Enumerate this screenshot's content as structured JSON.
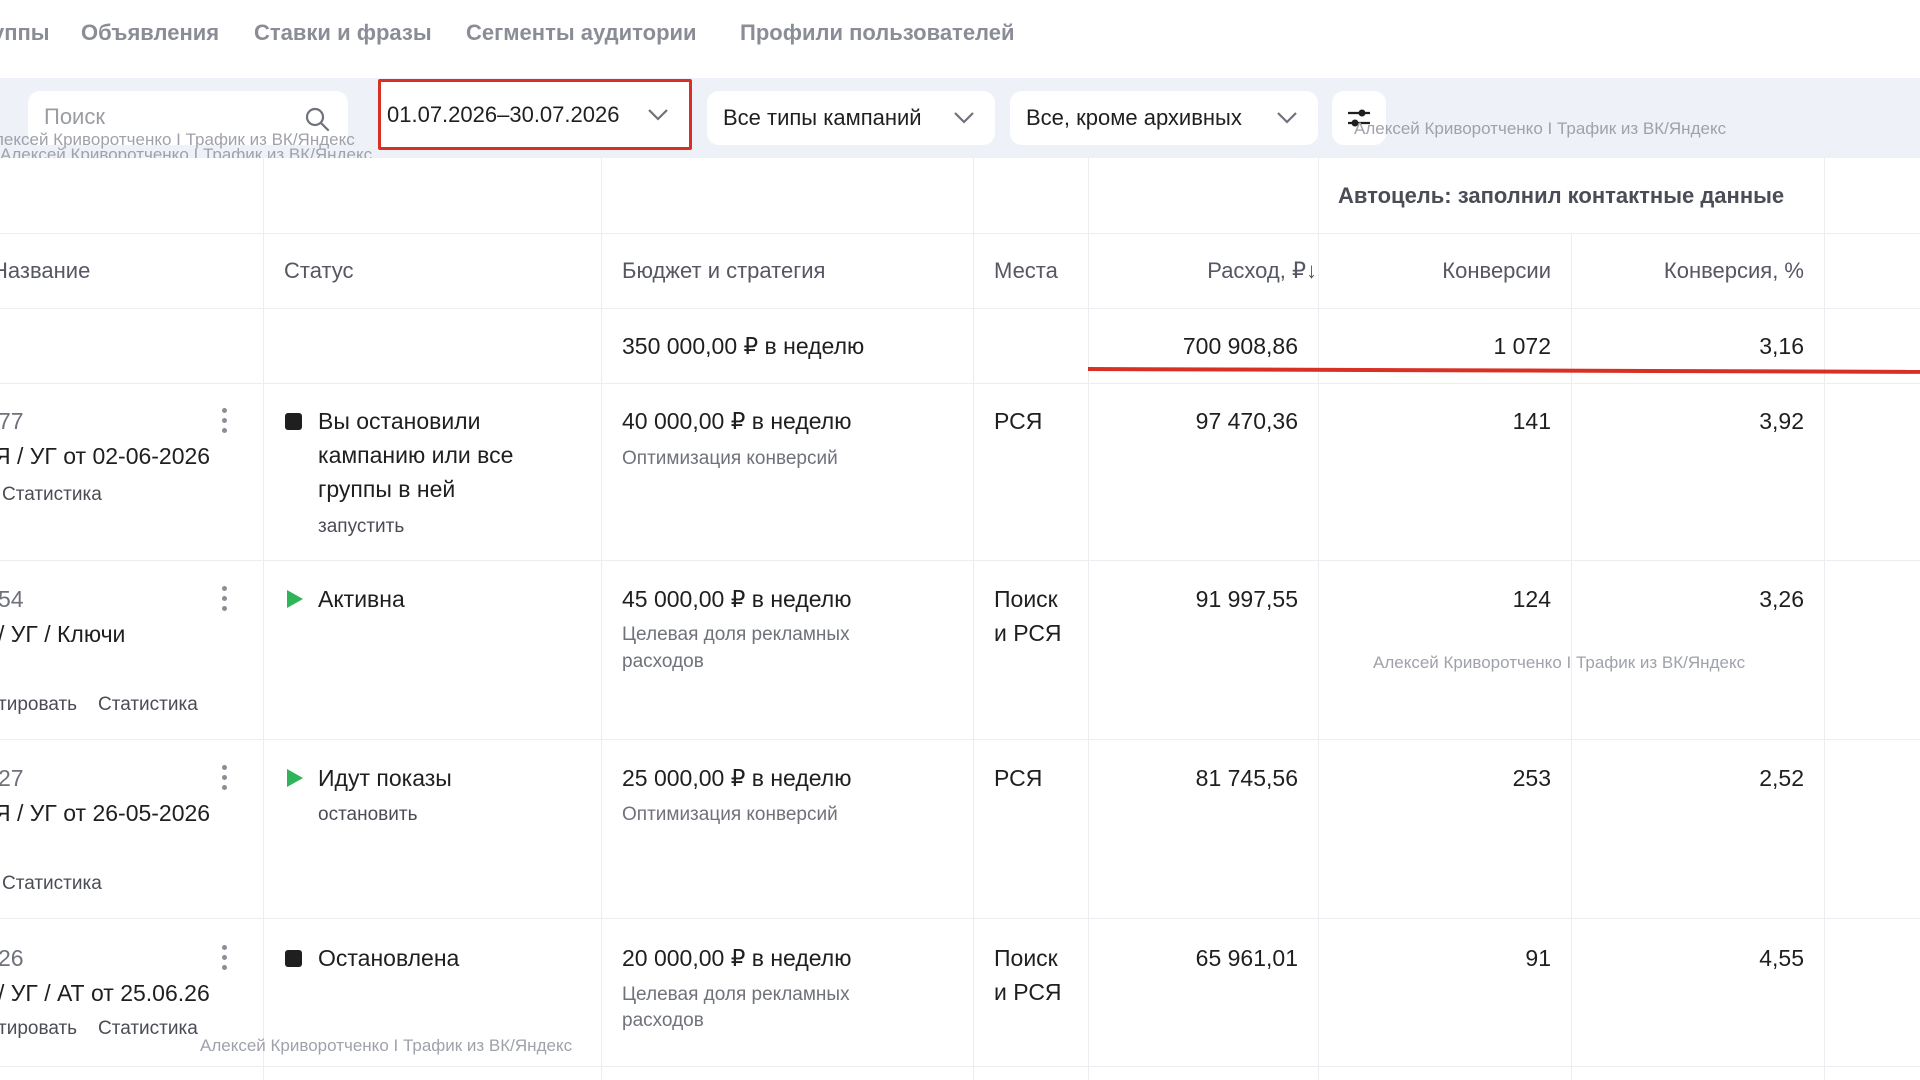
{
  "tabs": [
    "уппы",
    "Объявления",
    "Ставки и фразы",
    "Сегменты аудитории",
    "Профили пользователей"
  ],
  "toolbar": {
    "search_placeholder": "Поиск",
    "date_range": "01.07.2026–30.07.2026",
    "campaign_types": "Все типы кампаний",
    "archive_filter": "Все, кроме архивных"
  },
  "watermark": "Алексей Криворотченко I Трафик из ВК/Яндекс",
  "watermark_alt": "лексей Криворотченко I Трафик из ВК/Яндекс",
  "table": {
    "group_header": "Автоцель: заполнил контактные данные",
    "columns": {
      "name": "Название",
      "status": "Статус",
      "budget": "Бюджет и стратегия",
      "places": "Места",
      "spend": "Расход, ₽↓",
      "conversions": "Конверсии",
      "conversion_rate": "Конверсия, %"
    },
    "totals": {
      "budget": "350 000,00 ₽ в неделю",
      "spend": "700 908,86",
      "conversions": "1 072",
      "conversion_rate": "3,16"
    },
    "rows": [
      {
        "id": "77",
        "name": "Я / УГ от 02-06-2026",
        "links": [
          "Статистика"
        ],
        "status": "Вы остановили кампанию или все группы в ней",
        "status_lines": [
          "Вы остановили",
          "кампанию или все",
          "группы в ней"
        ],
        "status_action": "запустить",
        "budget": "40 000,00 ₽ в неделю",
        "strategy": "Оптимизация конверсий",
        "places": [
          "РСЯ"
        ],
        "spend": "97 470,36",
        "conversions": "141",
        "conversion_rate": "3,92"
      },
      {
        "id": "54",
        "name": "/ УГ / Ключи",
        "links": [
          "тировать",
          "Статистика"
        ],
        "status": "Активна",
        "status_lines": [
          "Активна"
        ],
        "status_action": "",
        "budget": "45 000,00 ₽ в неделю",
        "strategy": "Целевая доля рекламных расходов",
        "strategy_lines": [
          "Целевая доля рекламных",
          "расходов"
        ],
        "places": [
          "Поиск",
          "и РСЯ"
        ],
        "spend": "91 997,55",
        "conversions": "124",
        "conversion_rate": "3,26"
      },
      {
        "id": "27",
        "name": "Я / УГ от 26-05-2026",
        "links": [
          "Статистика"
        ],
        "status": "Идут показы",
        "status_lines": [
          "Идут показы"
        ],
        "status_action": "остановить",
        "budget": "25 000,00 ₽ в неделю",
        "strategy": "Оптимизация конверсий",
        "places": [
          "РСЯ"
        ],
        "spend": "81 745,56",
        "conversions": "253",
        "conversion_rate": "2,52"
      },
      {
        "id": "26",
        "name": "/ УГ / АТ от 25.06.26",
        "links": [
          "тировать",
          "Статистика"
        ],
        "status": "Остановлена",
        "status_lines": [
          "Остановлена"
        ],
        "status_action": "",
        "budget": "20 000,00 ₽ в неделю",
        "strategy": "Целевая доля рекламных расходов",
        "strategy_lines": [
          "Целевая доля рекламных",
          "расходов"
        ],
        "places": [
          "Поиск",
          "и РСЯ"
        ],
        "spend": "65 961,01",
        "conversions": "91",
        "conversion_rate": "4,55"
      }
    ]
  },
  "colors": {
    "accent_red": "#d93025",
    "active_green": "#2fb45a",
    "toolbar_bg": "#eef1f8"
  }
}
